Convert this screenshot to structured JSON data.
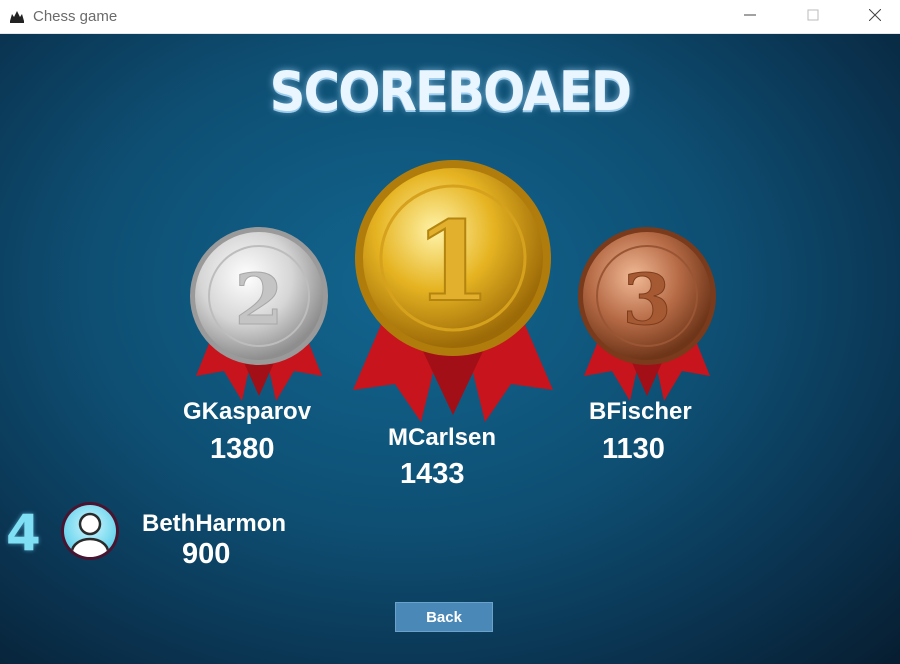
{
  "window": {
    "title": "Chess game",
    "icons": [
      "chess-piece-icon",
      "minimize-icon",
      "maximize-icon",
      "close-icon"
    ]
  },
  "scoreboard": {
    "heading": "SCOREBOAED",
    "podium": [
      {
        "rank": "1",
        "name": "MCarlsen",
        "score": "1433",
        "medal": "gold",
        "color": "#e6b422"
      },
      {
        "rank": "2",
        "name": "GKasparov",
        "score": "1380",
        "medal": "silver",
        "color": "#cfcfcf"
      },
      {
        "rank": "3",
        "name": "BFischer",
        "score": "1130",
        "medal": "bronze",
        "color": "#b56a45"
      }
    ],
    "others": [
      {
        "rank": "4",
        "name": "BethHarmon",
        "score": "900",
        "icon": "user-avatar-icon"
      }
    ]
  },
  "actions": {
    "back_label": "Back"
  },
  "colors": {
    "background": "#0e4f73",
    "button": "#4a88b7",
    "ribbon": "#c8141c"
  }
}
